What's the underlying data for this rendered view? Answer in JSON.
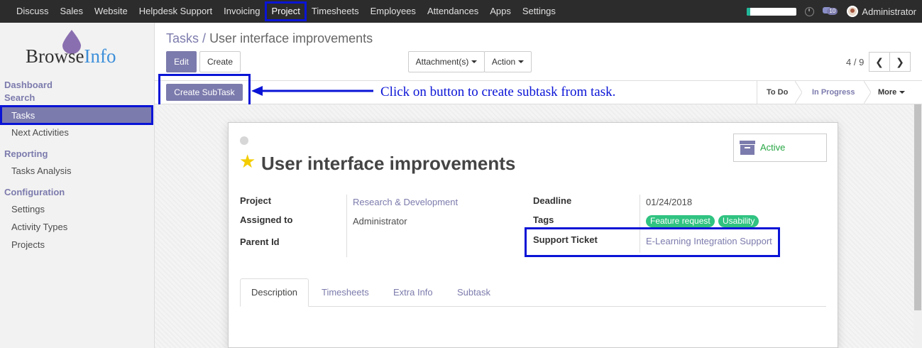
{
  "topnav": {
    "menu": [
      "Discuss",
      "Sales",
      "Website",
      "Helpdesk Support",
      "Invoicing",
      "Project",
      "Timesheets",
      "Employees",
      "Attendances",
      "Apps",
      "Settings"
    ],
    "active_index": 5,
    "message_count": "10",
    "user": "Administrator"
  },
  "logo": {
    "part1": "Browse",
    "part2": "Info"
  },
  "sidebar": {
    "dashboard": "Dashboard",
    "search": "Search",
    "tasks": "Tasks",
    "next_activities": "Next Activities",
    "reporting": "Reporting",
    "tasks_analysis": "Tasks Analysis",
    "configuration": "Configuration",
    "settings": "Settings",
    "activity_types": "Activity Types",
    "projects": "Projects"
  },
  "breadcrumb": {
    "parent": "Tasks",
    "sep": "/",
    "current": "User interface improvements"
  },
  "toolbar": {
    "edit": "Edit",
    "create": "Create",
    "attachments": "Attachment(s)",
    "action": "Action"
  },
  "pager": {
    "text": "4 / 9",
    "prev": "❮",
    "next": "❯"
  },
  "statusbar": {
    "create_subtask": "Create SubTask",
    "annotation": "Click on button to create subtask from task.",
    "stages": [
      "To Do",
      "In Progress"
    ],
    "active_stage": "In Progress",
    "more": "More"
  },
  "task": {
    "title": "User interface improvements",
    "active_label": "Active",
    "project_label": "Project",
    "project_value": "Research & Development",
    "assigned_label": "Assigned to",
    "assigned_value": "Administrator",
    "parent_label": "Parent Id",
    "deadline_label": "Deadline",
    "deadline_value": "01/24/2018",
    "tags_label": "Tags",
    "tags": [
      "Feature request",
      "Usability"
    ],
    "support_label": "Support Ticket",
    "support_value": "E-Learning Integration Support"
  },
  "tabs": [
    "Description",
    "Timesheets",
    "Extra Info",
    "Subtask"
  ],
  "colors": {
    "primary": "#7c7bad",
    "highlight": "#0a14d6",
    "tag": "#30c381",
    "active": "#28a745"
  }
}
